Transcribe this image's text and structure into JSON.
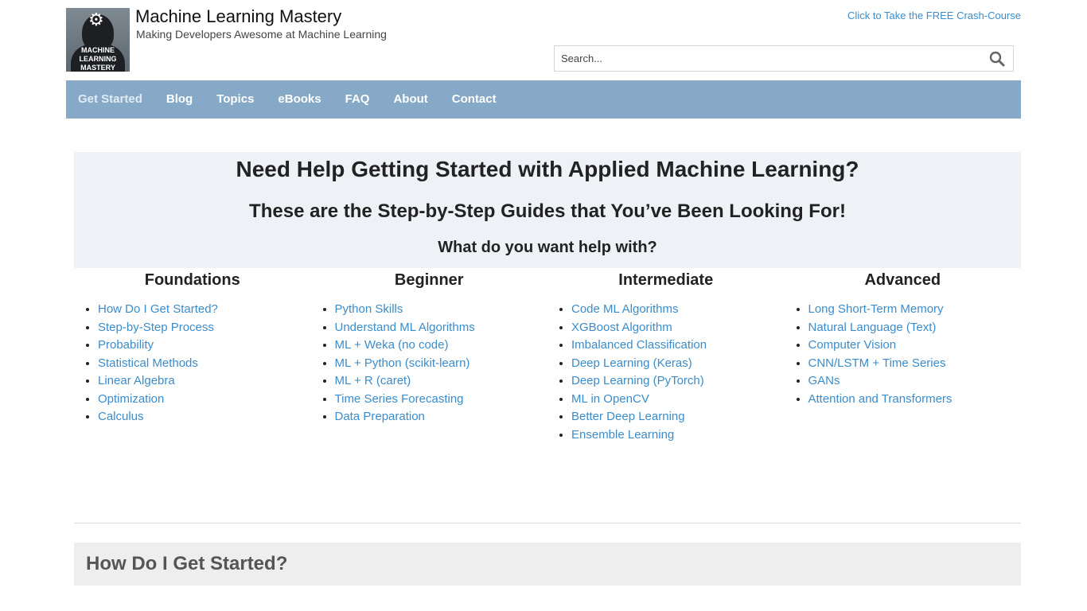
{
  "header": {
    "logo_text": "MACHINE LEARNING MASTERY",
    "site_title": "Machine Learning Mastery",
    "tagline": "Making Developers Awesome at Machine Learning",
    "crash_course_link": "Click to Take the FREE Crash-Course",
    "search": {
      "placeholder": "Search...",
      "icon": "search-icon"
    }
  },
  "nav": {
    "items": [
      "Get Started",
      "Blog",
      "Topics",
      "eBooks",
      "FAQ",
      "About",
      "Contact"
    ],
    "active": "Get Started"
  },
  "hero": {
    "title": "Need Help Getting Started with Applied Machine Learning?",
    "subtitle": "These are the Step-by-Step Guides that You’ve Been Looking For!",
    "question": "What do you want help with?"
  },
  "columns": [
    {
      "heading": "Foundations",
      "links": [
        "How Do I Get Started?",
        "Step-by-Step Process",
        "Probability",
        "Statistical Methods",
        "Linear Algebra",
        "Optimization",
        "Calculus"
      ]
    },
    {
      "heading": "Beginner",
      "links": [
        "Python Skills",
        "Understand ML Algorithms",
        "ML + Weka (no code)",
        "ML + Python (scikit-learn)",
        "ML + R (caret)",
        "Time Series Forecasting",
        "Data Preparation"
      ]
    },
    {
      "heading": "Intermediate",
      "links": [
        "Code ML Algorithms",
        "XGBoost Algorithm",
        "Imbalanced Classification",
        "Deep Learning (Keras)",
        "Deep Learning (PyTorch)",
        "ML in OpenCV",
        "Better Deep Learning",
        "Ensemble Learning"
      ]
    },
    {
      "heading": "Advanced",
      "links": [
        "Long Short-Term Memory",
        "Natural Language (Text)",
        "Computer Vision",
        "CNN/LSTM + Time Series",
        "GANs",
        "Attention and Transformers"
      ]
    }
  ],
  "section": {
    "title": "How Do I Get Started?"
  },
  "colors": {
    "nav_bg": "#85a9c6",
    "link": "#3b8ccb",
    "hero_bg": "#eef2f6",
    "section_bg": "#eeeeee"
  }
}
